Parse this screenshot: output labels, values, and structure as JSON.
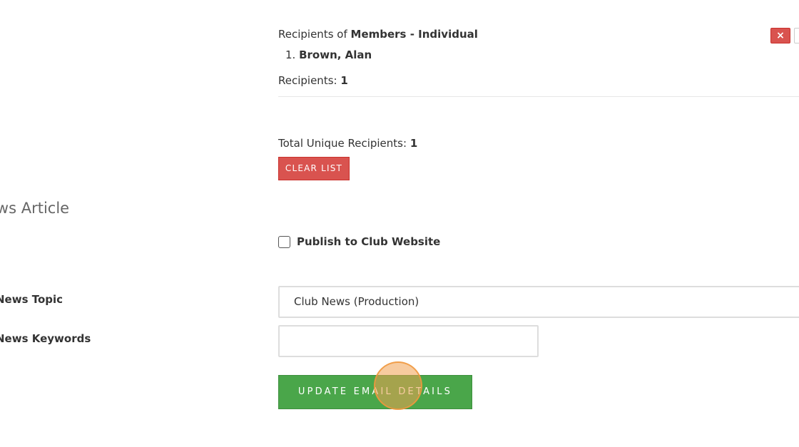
{
  "recipients_group": {
    "prefix": "Recipients of ",
    "group_name": "Members - Individual",
    "items": [
      {
        "index": "1.",
        "name": "Brown, Alan"
      }
    ],
    "count_label": "Recipients: ",
    "count_value": "1",
    "remove_icon": "×"
  },
  "totals": {
    "label": "Total Unique Recipients: ",
    "value": "1"
  },
  "clear_button_label": "CLEAR LIST",
  "news_section": {
    "heading": "ews Article",
    "publish_label": "Publish to Club Website",
    "publish_checked": false,
    "topic_label": "News Topic",
    "topic_value": "Club News (Production)",
    "keywords_label": "News Keywords",
    "keywords_value": ""
  },
  "update_button_label": "UPDATE EMAIL DETAILS",
  "colors": {
    "danger": "#d9534f",
    "success": "#4aa64a",
    "click_indicator": "#f0a050"
  }
}
